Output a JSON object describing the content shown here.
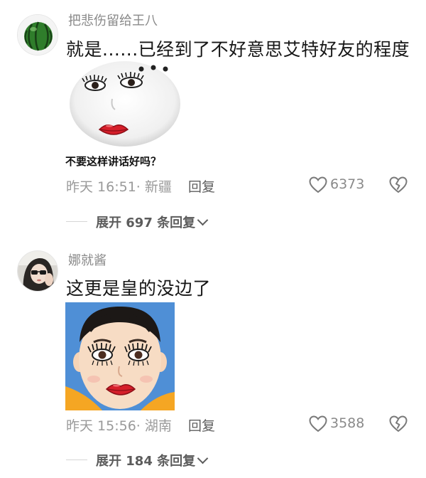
{
  "comments": [
    {
      "username": "把悲伤留给王八",
      "text": "就是......已经到了不好意思艾特好友的程度",
      "sticker_caption": "不要这样讲话好吗？",
      "time_location": "昨天 16:51· 新疆",
      "reply_label": "回复",
      "likes": "6373",
      "expand_label": "展开 697 条回复",
      "avatar_icon": "watermelon-icon"
    },
    {
      "username": "娜就酱",
      "text": "这更是皇的没边了",
      "time_location": "昨天 15:56· 湖南",
      "reply_label": "回复",
      "likes": "3588",
      "expand_label": "展开 184 条回复",
      "avatar_icon": "user-photo-icon"
    }
  ],
  "colors": {
    "username": "#8a8a8a",
    "text": "#161616",
    "meta": "#9a9a9a",
    "accent_red": "#d61f2a"
  }
}
